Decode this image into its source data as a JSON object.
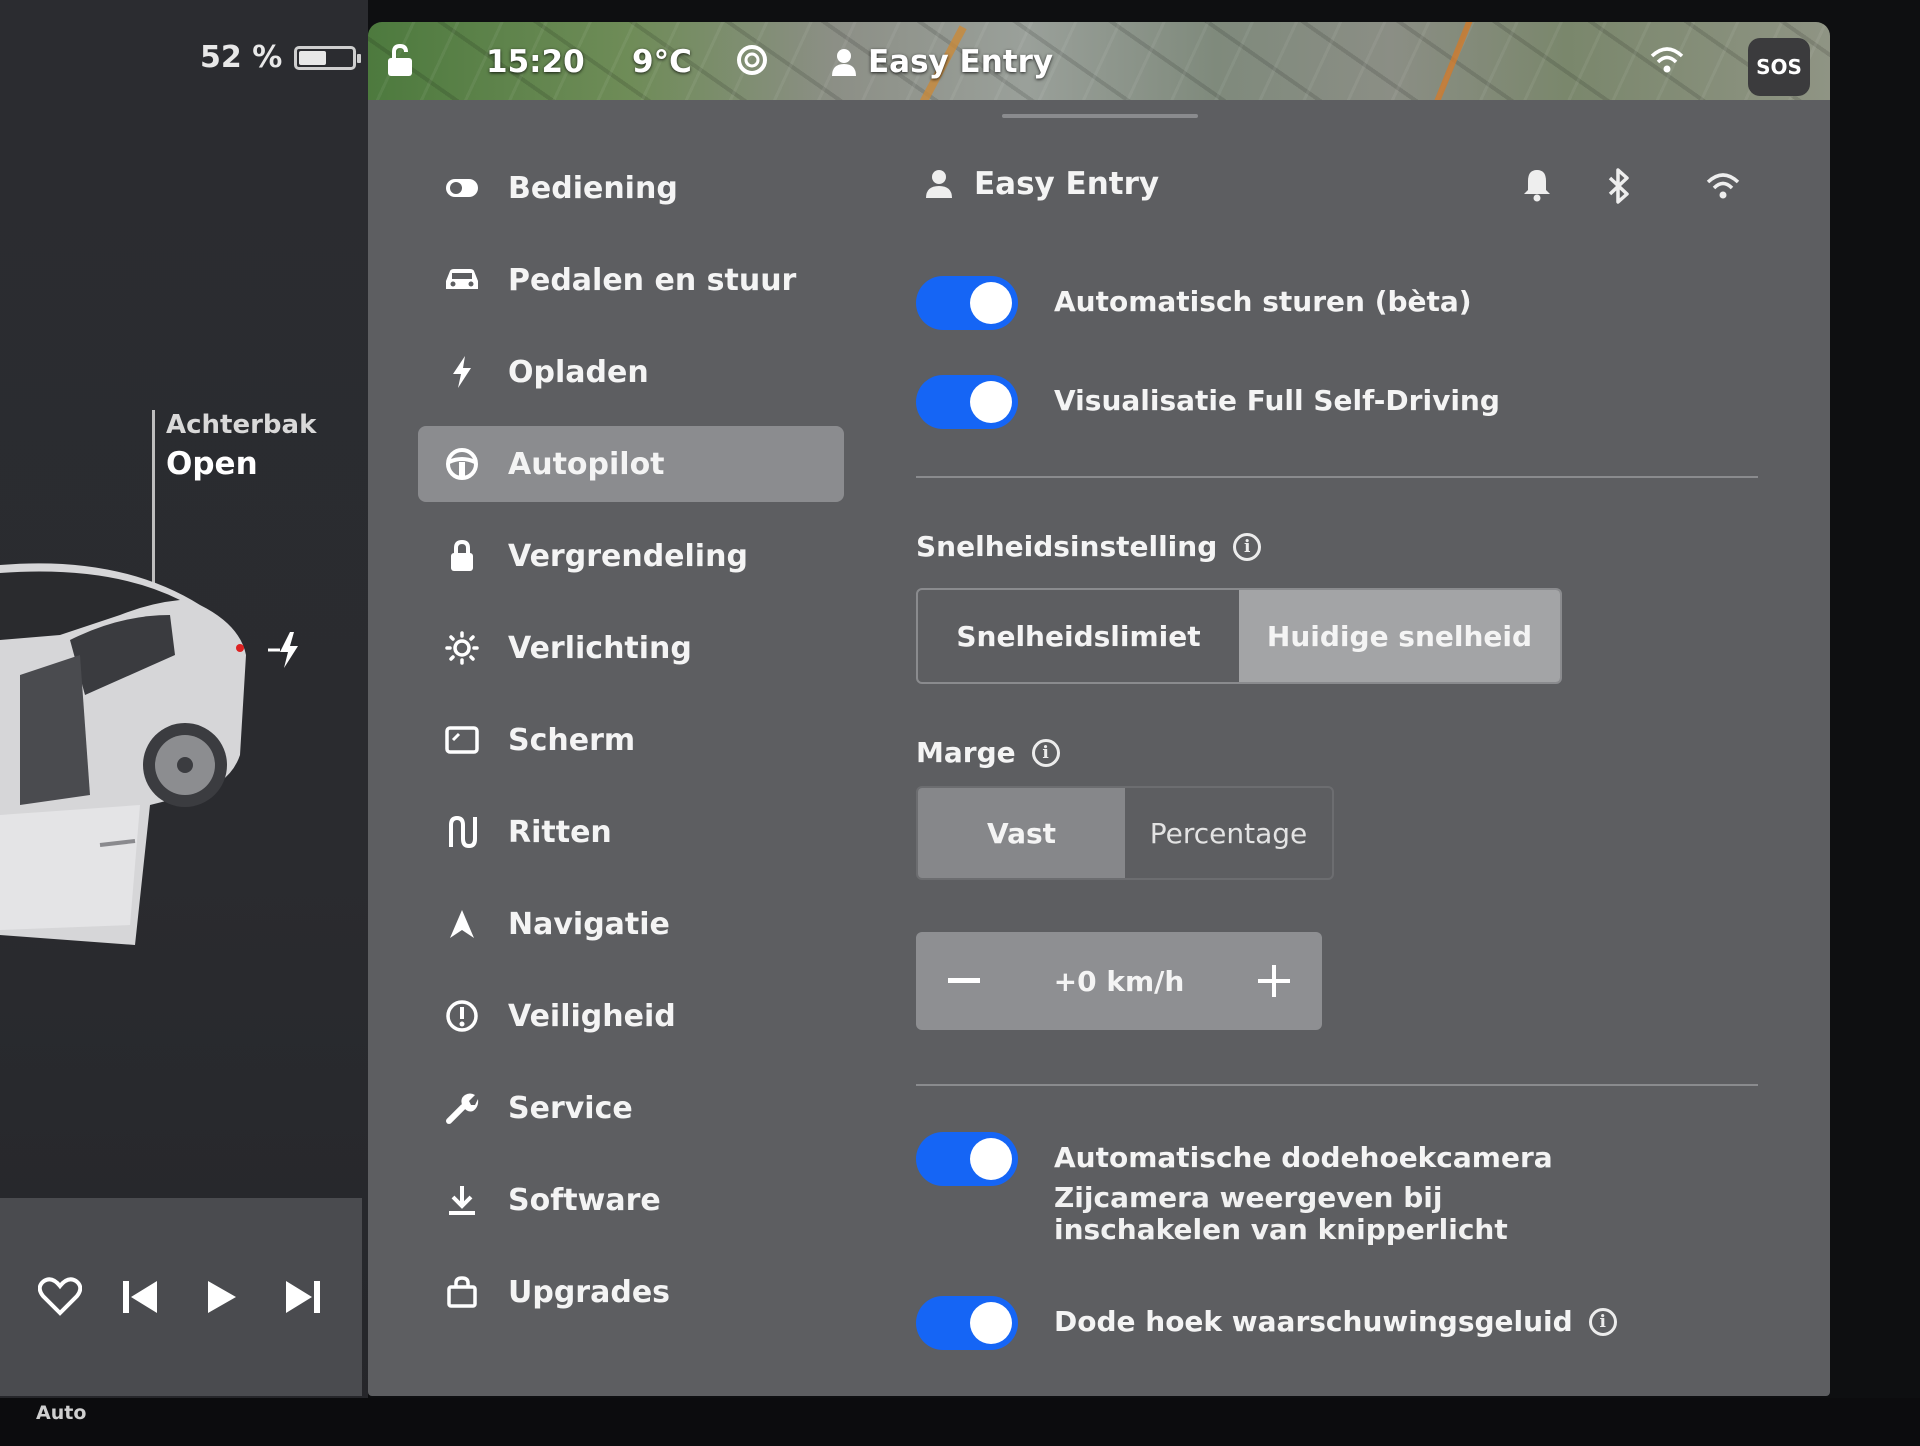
{
  "status": {
    "battery_percent": "52 %",
    "battery_level": 0.52,
    "time": "15:20",
    "temperature": "9°C",
    "profile": "Easy Entry",
    "sos_label": "SOS"
  },
  "car": {
    "trunk_title": "Achterbak",
    "trunk_status": "Open"
  },
  "media": {
    "buttons": [
      "heart-icon",
      "previous-track-icon",
      "play-icon",
      "next-track-icon"
    ]
  },
  "bottom": {
    "auto_label": "Auto"
  },
  "nav": {
    "items": [
      {
        "label": "Bediening",
        "icon": "toggle-icon"
      },
      {
        "label": "Pedalen en stuur",
        "icon": "car-icon"
      },
      {
        "label": "Opladen",
        "icon": "bolt-icon"
      },
      {
        "label": "Autopilot",
        "icon": "steering-wheel-icon",
        "active": true
      },
      {
        "label": "Vergrendeling",
        "icon": "lock-icon"
      },
      {
        "label": "Verlichting",
        "icon": "sun-icon"
      },
      {
        "label": "Scherm",
        "icon": "display-icon"
      },
      {
        "label": "Ritten",
        "icon": "trips-icon"
      },
      {
        "label": "Navigatie",
        "icon": "navigation-icon"
      },
      {
        "label": "Veiligheid",
        "icon": "alert-icon"
      },
      {
        "label": "Service",
        "icon": "wrench-icon"
      },
      {
        "label": "Software",
        "icon": "download-icon"
      },
      {
        "label": "Upgrades",
        "icon": "bag-icon"
      }
    ]
  },
  "header": {
    "profile_name": "Easy Entry"
  },
  "toggles": {
    "autosteer": {
      "label": "Automatisch sturen (bèta)",
      "on": true
    },
    "fsd_visual": {
      "label": "Visualisatie Full Self-Driving",
      "on": true
    },
    "blindspot_cam": {
      "label": "Automatische dodehoekcamera",
      "sub": "Zijcamera weergeven bij inschakelen van knipperlicht",
      "on": true
    },
    "blindspot_chime": {
      "label": "Dode hoek waarschuwingsgeluid",
      "on": true
    }
  },
  "speed_setting": {
    "label": "Snelheidsinstelling",
    "options": [
      "Snelheidslimiet",
      "Huidige snelheid"
    ],
    "selected": "Huidige snelheid"
  },
  "margin": {
    "label": "Marge",
    "options": [
      "Vast",
      "Percentage"
    ],
    "selected": "Vast",
    "value": "+0 km/h"
  },
  "colors": {
    "accent": "#1565f5",
    "panel": "#5d5e61"
  }
}
